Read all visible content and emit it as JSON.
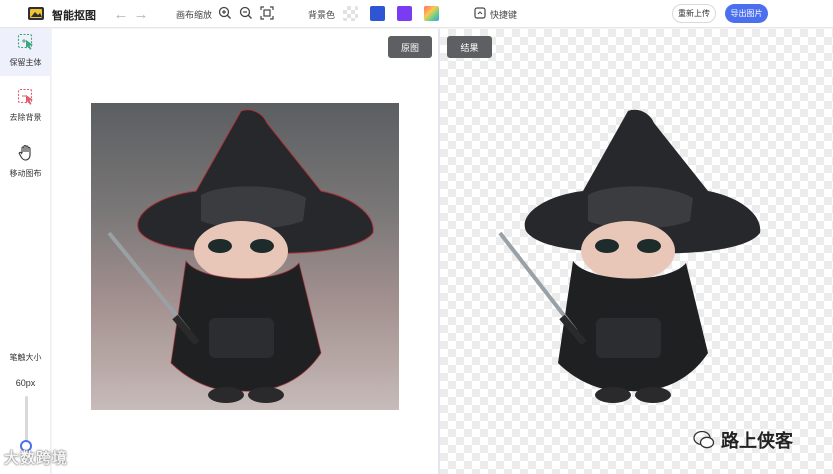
{
  "app": {
    "title": "智能抠图"
  },
  "toolbar": {
    "canvas_zoom_label": "画布缩放",
    "bg_color_label": "背景色",
    "shortcut_label": "快捷键",
    "reupload_label": "重新上传",
    "export_label": "导出图片",
    "swatches": [
      "#2f55d4",
      "#7a3cf0",
      "gradient"
    ]
  },
  "sidebar": {
    "tools": [
      {
        "label": "保留主体",
        "icon": "keep-subject-icon",
        "active": true
      },
      {
        "label": "去除背景",
        "icon": "remove-bg-icon",
        "active": false
      },
      {
        "label": "移动图布",
        "icon": "hand-move-icon",
        "active": false
      }
    ],
    "brush_size_label": "笔触大小",
    "brush_size_value": "60px"
  },
  "canvas": {
    "original_label": "原图",
    "result_label": "结果"
  },
  "watermarks": {
    "left": "大数跨境",
    "right": "路上侠客"
  }
}
